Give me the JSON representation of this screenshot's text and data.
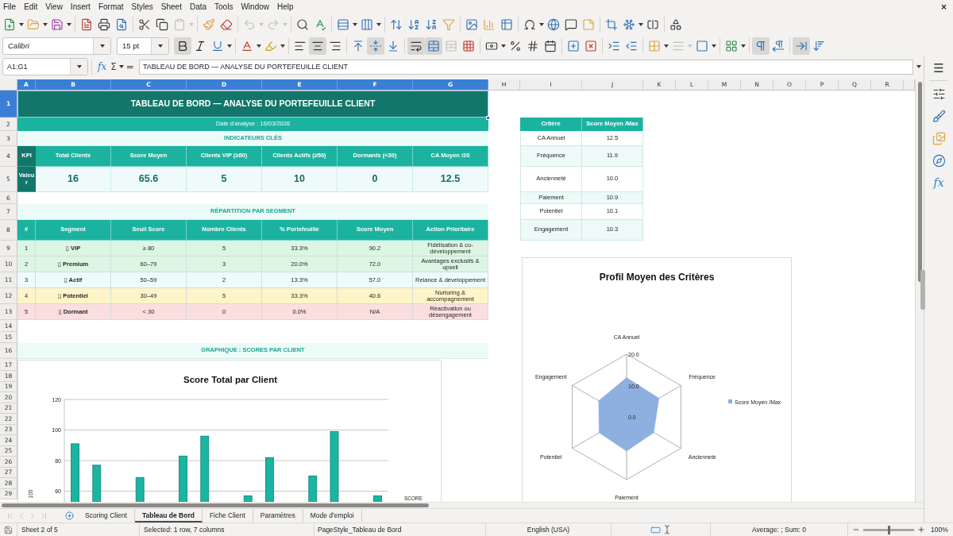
{
  "menu_bar": {
    "items": [
      "File",
      "Edit",
      "View",
      "Insert",
      "Format",
      "Styles",
      "Sheet",
      "Data",
      "Tools",
      "Window",
      "Help"
    ],
    "close": "×"
  },
  "standard_toolbar": {
    "paste_disabled": true,
    "undo_disabled": true,
    "redo_disabled": true
  },
  "formatting_toolbar": {
    "font_name": "Calibri",
    "font_size": "15 pt",
    "bold": true,
    "italic": false,
    "underline": false,
    "align_left": false,
    "align_center": true,
    "align_right": false,
    "align_top": false,
    "align_middle": true,
    "align_bottom": false,
    "wrap_text": true,
    "merge_cells": true,
    "unmerge_disabled": true,
    "border_style_disabled": true,
    "left_to_right": true,
    "right_to_left": false,
    "text_left_to_right": true,
    "text_top_to_bottom": false
  },
  "formula_bar": {
    "name_box": "A1:G1",
    "function_wizard": "fx",
    "sum": "Σ",
    "equals": "=",
    "content": "TABLEAU DE BORD — ANALYSE DU PORTEFEUILLE CLIENT"
  },
  "sidebar": {
    "menu": "☰",
    "functions": "fx"
  },
  "sheet": {
    "columns": [
      {
        "label": "A",
        "selected": true
      },
      {
        "label": "B",
        "selected": true
      },
      {
        "label": "C",
        "selected": true
      },
      {
        "label": "D",
        "selected": true
      },
      {
        "label": "E",
        "selected": true
      },
      {
        "label": "F",
        "selected": true
      },
      {
        "label": "G",
        "selected": true
      },
      {
        "label": "H",
        "selected": false
      },
      {
        "label": "I",
        "selected": false
      },
      {
        "label": "J",
        "selected": false
      },
      {
        "label": "K",
        "selected": false
      },
      {
        "label": "L",
        "selected": false
      },
      {
        "label": "M",
        "selected": false
      },
      {
        "label": "N",
        "selected": false
      },
      {
        "label": "O",
        "selected": false
      },
      {
        "label": "P",
        "selected": false
      },
      {
        "label": "Q",
        "selected": false
      },
      {
        "label": "R",
        "selected": false
      }
    ],
    "rows": [
      {
        "label": "1",
        "selected": true
      },
      {
        "label": "2",
        "selected": false
      },
      {
        "label": "3",
        "selected": false
      },
      {
        "label": "4",
        "selected": false
      },
      {
        "label": "5",
        "selected": false
      },
      {
        "label": "6",
        "selected": false
      },
      {
        "label": "7",
        "selected": false
      },
      {
        "label": "8",
        "selected": false
      },
      {
        "label": "9",
        "selected": false
      },
      {
        "label": "10",
        "selected": false
      },
      {
        "label": "11",
        "selected": false
      },
      {
        "label": "12",
        "selected": false
      },
      {
        "label": "13",
        "selected": false
      },
      {
        "label": "14",
        "selected": false
      },
      {
        "label": "15",
        "selected": false
      },
      {
        "label": "16",
        "selected": false
      },
      {
        "label": "17",
        "selected": false
      },
      {
        "label": "18",
        "selected": false
      },
      {
        "label": "19",
        "selected": false
      },
      {
        "label": "20",
        "selected": false
      },
      {
        "label": "21",
        "selected": false
      },
      {
        "label": "22",
        "selected": false
      },
      {
        "label": "23",
        "selected": false
      },
      {
        "label": "24",
        "selected": false
      },
      {
        "label": "25",
        "selected": false
      },
      {
        "label": "26",
        "selected": false
      },
      {
        "label": "27",
        "selected": false
      },
      {
        "label": "28",
        "selected": false
      },
      {
        "label": "29",
        "selected": false
      }
    ],
    "title": "TABLEAU DE BORD — ANALYSE DU PORTEFEUILLE CLIENT",
    "date": "Date d'analyse : 16/03/2026",
    "kpi_heading": "INDICATEURS CLÉS",
    "kpi": {
      "header": "KPI",
      "value_label": "Valeur",
      "items": [
        {
          "label": "Total Clients",
          "value": "16"
        },
        {
          "label": "Score Moyen",
          "value": "65.6"
        },
        {
          "label": "Clients VIP (≥80)",
          "value": "5"
        },
        {
          "label": "Clients Actifs (≥50)",
          "value": "10"
        },
        {
          "label": "Dormants (<30)",
          "value": "0"
        },
        {
          "label": "CA Moyen /20",
          "value": "12.5"
        }
      ]
    },
    "segment_heading": "RÉPARTITION PAR SEGMENT",
    "segments": {
      "columns": [
        "#",
        "Segment",
        "Seuil Score",
        "Nombre Clients",
        "% Portefeuille",
        "Score Moyen",
        "Action Prioritaire"
      ],
      "rows": [
        {
          "color": "#dcf6e3",
          "cells": [
            "1",
            "▯ VIP",
            "≥ 80",
            "5",
            "33.3%",
            "90.2",
            "Fidélisation & co-développement"
          ]
        },
        {
          "color": "#dcf6e3",
          "cells": [
            "2",
            "▯ Premium",
            "60–79",
            "3",
            "20.0%",
            "72.0",
            "Avantages exclusifs & upsell"
          ]
        },
        {
          "color": "#edfbfa",
          "cells": [
            "3",
            "▯ Actif",
            "50–59",
            "2",
            "13.3%",
            "57.0",
            "Relance & développement"
          ]
        },
        {
          "color": "#fdf4c8",
          "cells": [
            "4",
            "▯ Potentiel",
            "30–49",
            "5",
            "33.3%",
            "40.6",
            "Nurturing & accompagnement"
          ]
        },
        {
          "color": "#fbdede",
          "cells": [
            "5",
            "▯ Dormant",
            "< 30",
            "0",
            "0.0%",
            "N/A",
            "Réactivation ou désengagement"
          ]
        }
      ]
    },
    "chart_heading": "GRAPHIQUE : SCORES PAR CLIENT",
    "criteria": {
      "columns": [
        "Critère",
        "Score Moyen /Max"
      ],
      "rows": [
        {
          "name": "CA Annuel",
          "value": "12.5"
        },
        {
          "name": "Fréquence",
          "value": "11.9"
        },
        {
          "name": "Ancienneté",
          "value": "10.0"
        },
        {
          "name": "Paiement",
          "value": "10.9"
        },
        {
          "name": "Potentiel",
          "value": "10.1"
        },
        {
          "name": "Engagement",
          "value": "10.3"
        }
      ]
    },
    "bar_chart": {
      "chart_data": {
        "type": "bar",
        "title": "Score Total par Client",
        "xlabel": "SCORE",
        "ylabel": "100",
        "ylim": [
          52.5,
          120
        ],
        "yticks": [
          60,
          80,
          100,
          120
        ],
        "grid": true,
        "series": [
          {
            "color": "#1ab5a2",
            "values": [
              91,
              77,
              null,
              69,
              null,
              83,
              96,
              null,
              57,
              82,
              null,
              70,
              99,
              null,
              57
            ]
          }
        ]
      }
    },
    "radar_chart": {
      "chart_data": {
        "type": "radar",
        "title": "Profil Moyen des Critères",
        "categories": [
          "CA Annuel",
          "Fréquence",
          "Ancienneté",
          "Paiement",
          "Potentiel",
          "Engagement"
        ],
        "ylim": [
          0,
          20
        ],
        "yticks": [
          {
            "value": 0,
            "label": "0.0"
          },
          {
            "value": 10,
            "label": "10.0"
          },
          {
            "value": 20,
            "label": "20.0"
          }
        ],
        "series": [
          {
            "name": "Score Moyen /Max",
            "color": "#8db0e1",
            "values": [
              12.5,
              11.9,
              10.0,
              10.9,
              10.1,
              10.3
            ]
          }
        ]
      }
    }
  },
  "sheet_tabs": {
    "navigation_disabled": true,
    "tabs": [
      {
        "label": "Scoring Client",
        "selected": false
      },
      {
        "label": "Tableau de Bord",
        "selected": true
      },
      {
        "label": "Fiche Client",
        "selected": false
      },
      {
        "label": "Paramètres",
        "selected": false
      },
      {
        "label": "Mode d'emploi",
        "selected": false
      }
    ]
  },
  "status_bar": {
    "sheet": "Sheet 2 of 5",
    "selection": "Selected: 1 row, 7 columns",
    "page_style": "PageStyle_Tableau de Bord",
    "language": "English (USA)",
    "summary": "Average: ; Sum: 0",
    "zoom": "100%",
    "zoom_slider": {
      "level": 0.5
    }
  }
}
